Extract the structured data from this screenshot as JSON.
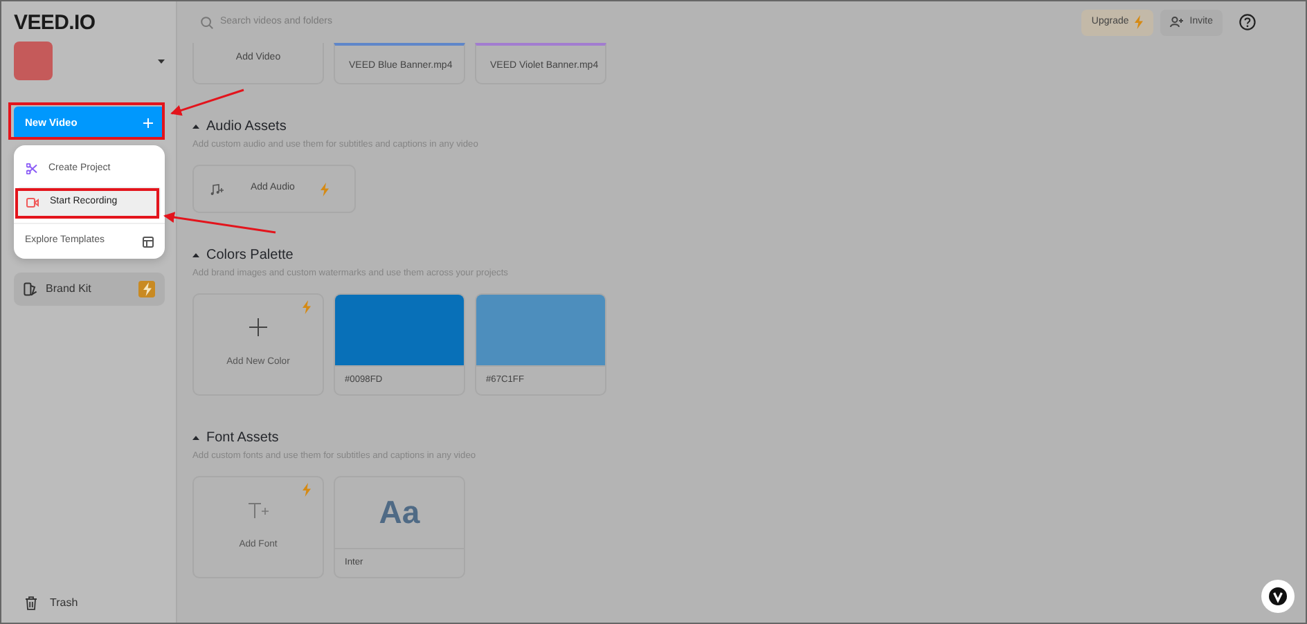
{
  "sidebar": {
    "logo": "VEED.IO",
    "new_video": {
      "label": "New Video"
    },
    "menu": [
      {
        "label": "Create Project",
        "kind": "project",
        "selected": false
      },
      {
        "label": "Start Recording",
        "kind": "record",
        "selected": true
      },
      {
        "label": "Explore Templates",
        "kind": "templates",
        "selected": false
      }
    ],
    "items": [
      {
        "label": "Brand Kit",
        "selected": true,
        "premium": true
      }
    ],
    "footer_items": [
      {
        "label": "Trash"
      }
    ]
  },
  "topbar": {
    "search": {
      "placeholder": "Search videos and folders"
    },
    "buttons": [
      {
        "label": "Upgrade",
        "kind": "upgrade"
      },
      {
        "label": "Invite",
        "kind": "invite"
      }
    ]
  },
  "video_assets": {
    "cards": [
      {
        "label": "Add Video",
        "kind": "add"
      },
      {
        "label": "VEED Blue Banner.mp4",
        "kind": "video",
        "color": "#5f86c9"
      },
      {
        "label": "VEED Violet Banner.mp4",
        "kind": "video",
        "color": "#a27cd0"
      }
    ]
  },
  "sections": [
    {
      "title": "Audio Assets",
      "expanded": true,
      "subtitle": "Add custom audio and use them for subtitles and captions in any video",
      "cards": [
        {
          "label": "Add Audio",
          "kind": "add_audio",
          "premium": true
        }
      ]
    },
    {
      "title": "Colors Palette",
      "expanded": true,
      "subtitle": "Add brand images and custom watermarks and use them across your projects",
      "cards": [
        {
          "label": "Add New Color",
          "kind": "add_color",
          "premium": true
        },
        {
          "label": "#0098FD",
          "kind": "swatch",
          "color": "#0870b8"
        },
        {
          "label": "#67C1FF",
          "kind": "swatch",
          "color": "#4d8ebd"
        }
      ]
    },
    {
      "title": "Font Assets",
      "expanded": true,
      "subtitle": "Add custom fonts and use them for subtitles and captions in any video",
      "cards": [
        {
          "label": "Add Font",
          "kind": "add_font",
          "premium": true
        },
        {
          "label": "Inter",
          "kind": "font",
          "sample": "Aa"
        }
      ]
    }
  ]
}
